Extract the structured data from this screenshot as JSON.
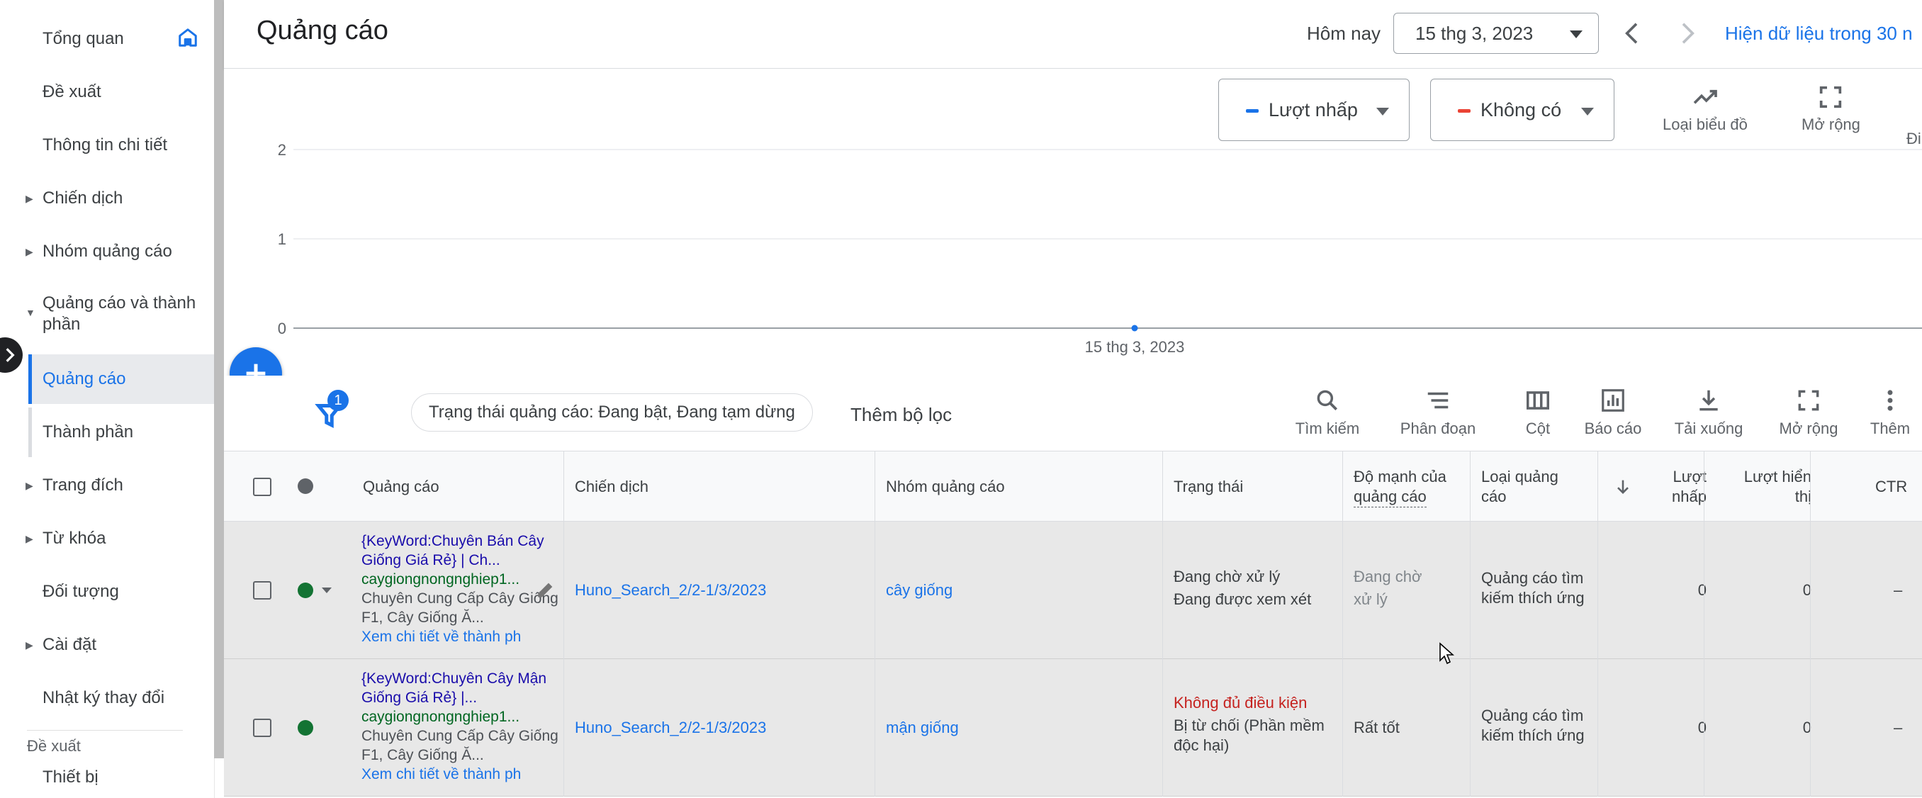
{
  "sidebar": {
    "items": [
      {
        "label": "Tổng quan"
      },
      {
        "label": "Đề xuất"
      },
      {
        "label": "Thông tin chi tiết"
      },
      {
        "label": "Chiến dịch"
      },
      {
        "label": "Nhóm quảng cáo"
      },
      {
        "label": "Quảng cáo và thành phần"
      },
      {
        "label": "Quảng cáo"
      },
      {
        "label": "Thành phần"
      },
      {
        "label": "Trang đích"
      },
      {
        "label": "Từ khóa"
      },
      {
        "label": "Đối tượng"
      },
      {
        "label": "Cài đặt"
      },
      {
        "label": "Nhật ký thay đổi"
      }
    ],
    "section_heading": "Đề xuất",
    "section_item": "Thiết bị"
  },
  "header": {
    "title": "Quảng cáo",
    "today_label": "Hôm nay",
    "date_value": "15 thg 3, 2023",
    "data_link": "Hiện dữ liệu trong 30 n"
  },
  "chart_controls": {
    "metric1": {
      "label": "Lượt nhấp",
      "color": "#1a73e8"
    },
    "metric2": {
      "label": "Không có",
      "color": "#ea4335"
    },
    "chart_type": "Loại biểu đồ",
    "expand": "Mở rộng",
    "more": "Đi"
  },
  "chart_data": {
    "type": "line",
    "x": [
      "15 thg 3, 2023"
    ],
    "series": [
      {
        "values": [
          0
        ]
      }
    ],
    "yticks": [
      0,
      1,
      2
    ],
    "ylim": [
      0,
      2
    ],
    "grid": true
  },
  "filter_bar": {
    "filter_count": "1",
    "chip": "Trạng thái quảng cáo: Đang bật, Đang tạm dừng",
    "add_filter": "Thêm bộ lọc",
    "tools": [
      "Tìm kiếm",
      "Phân đoạn",
      "Cột",
      "Báo cáo",
      "Tải xuống",
      "Mở rộng",
      "Thêm"
    ]
  },
  "table": {
    "headers": {
      "ad": "Quảng cáo",
      "campaign": "Chiến dịch",
      "ad_group": "Nhóm quảng cáo",
      "status": "Trạng thái",
      "strength_1": "Độ mạnh của",
      "strength_2": "quảng cáo",
      "type_1": "Loại quảng",
      "type_2": "cáo",
      "clicks_1": "Lượt",
      "clicks_2": "nhấp",
      "impr_1": "Lượt hiển",
      "impr_2": "thị",
      "ctr": "CTR"
    },
    "rows": [
      {
        "ad_title": "{KeyWord:Chuyên Bán Cây Giống Giá Rẻ} | Ch...",
        "ad_url": "caygiongnongnghiep1...",
        "ad_desc": "Chuyên Cung Cấp Cây Giống F1, Cây Giống Ă...",
        "ad_link": "Xem chi tiết về thành ph",
        "campaign": "Huno_Search_2/2-1/3/2023",
        "ad_group": "cây giống",
        "status_1": "Đang chờ xử lý",
        "status_2": "Đang được xem xét",
        "strength_1": "Đang chờ",
        "strength_2": "xử lý",
        "type_1": "Quảng cáo tìm",
        "type_2": "kiếm thích ứng",
        "clicks": "0",
        "impressions": "0",
        "ctr": "–"
      },
      {
        "ad_title": "{KeyWord:Chuyên Cây Mận Giống Giá Rẻ} |...",
        "ad_url": "caygiongnongnghiep1...",
        "ad_desc": "Chuyên Cung Cấp Cây Giống F1, Cây Giống Ă...",
        "ad_link": "Xem chi tiết về thành ph",
        "campaign": "Huno_Search_2/2-1/3/2023",
        "ad_group": "mận giống",
        "status_1": "Không đủ điều kiện",
        "status_2": "Bị từ chối (Phần mềm",
        "status_3": "độc hại)",
        "strength": "Rất tốt",
        "type_1": "Quảng cáo tìm",
        "type_2": "kiếm thích ứng",
        "clicks": "0",
        "impressions": "0",
        "ctr": "–"
      }
    ]
  }
}
